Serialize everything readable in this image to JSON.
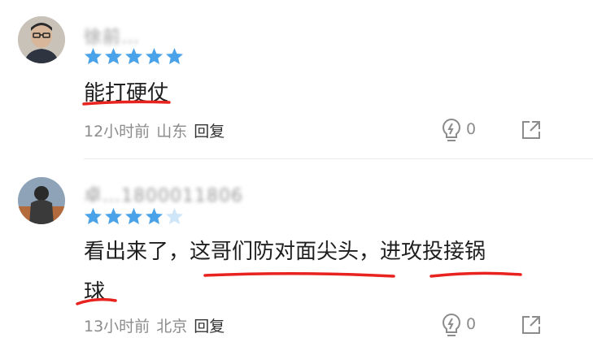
{
  "colors": {
    "star_full": "#4aa3e8",
    "star_empty": "#cfe6f8",
    "underline": "#e8231f"
  },
  "comments": [
    {
      "username": "徐前…",
      "rating": 5,
      "content_lines": [
        "能打硬仗"
      ],
      "time": "12小时前",
      "location": "山东",
      "reply_label": "回复",
      "likes": "0",
      "icons": {
        "like": "lightbulb-like-icon",
        "share": "share-icon"
      }
    },
    {
      "username": "卓…1800011806",
      "rating": 4,
      "content_lines": [
        "看出来了，这哥们防对面尖头，进攻投接锅",
        "球"
      ],
      "time": "13小时前",
      "location": "北京",
      "reply_label": "回复",
      "likes": "0",
      "icons": {
        "like": "lightbulb-like-icon",
        "share": "share-icon"
      }
    }
  ]
}
